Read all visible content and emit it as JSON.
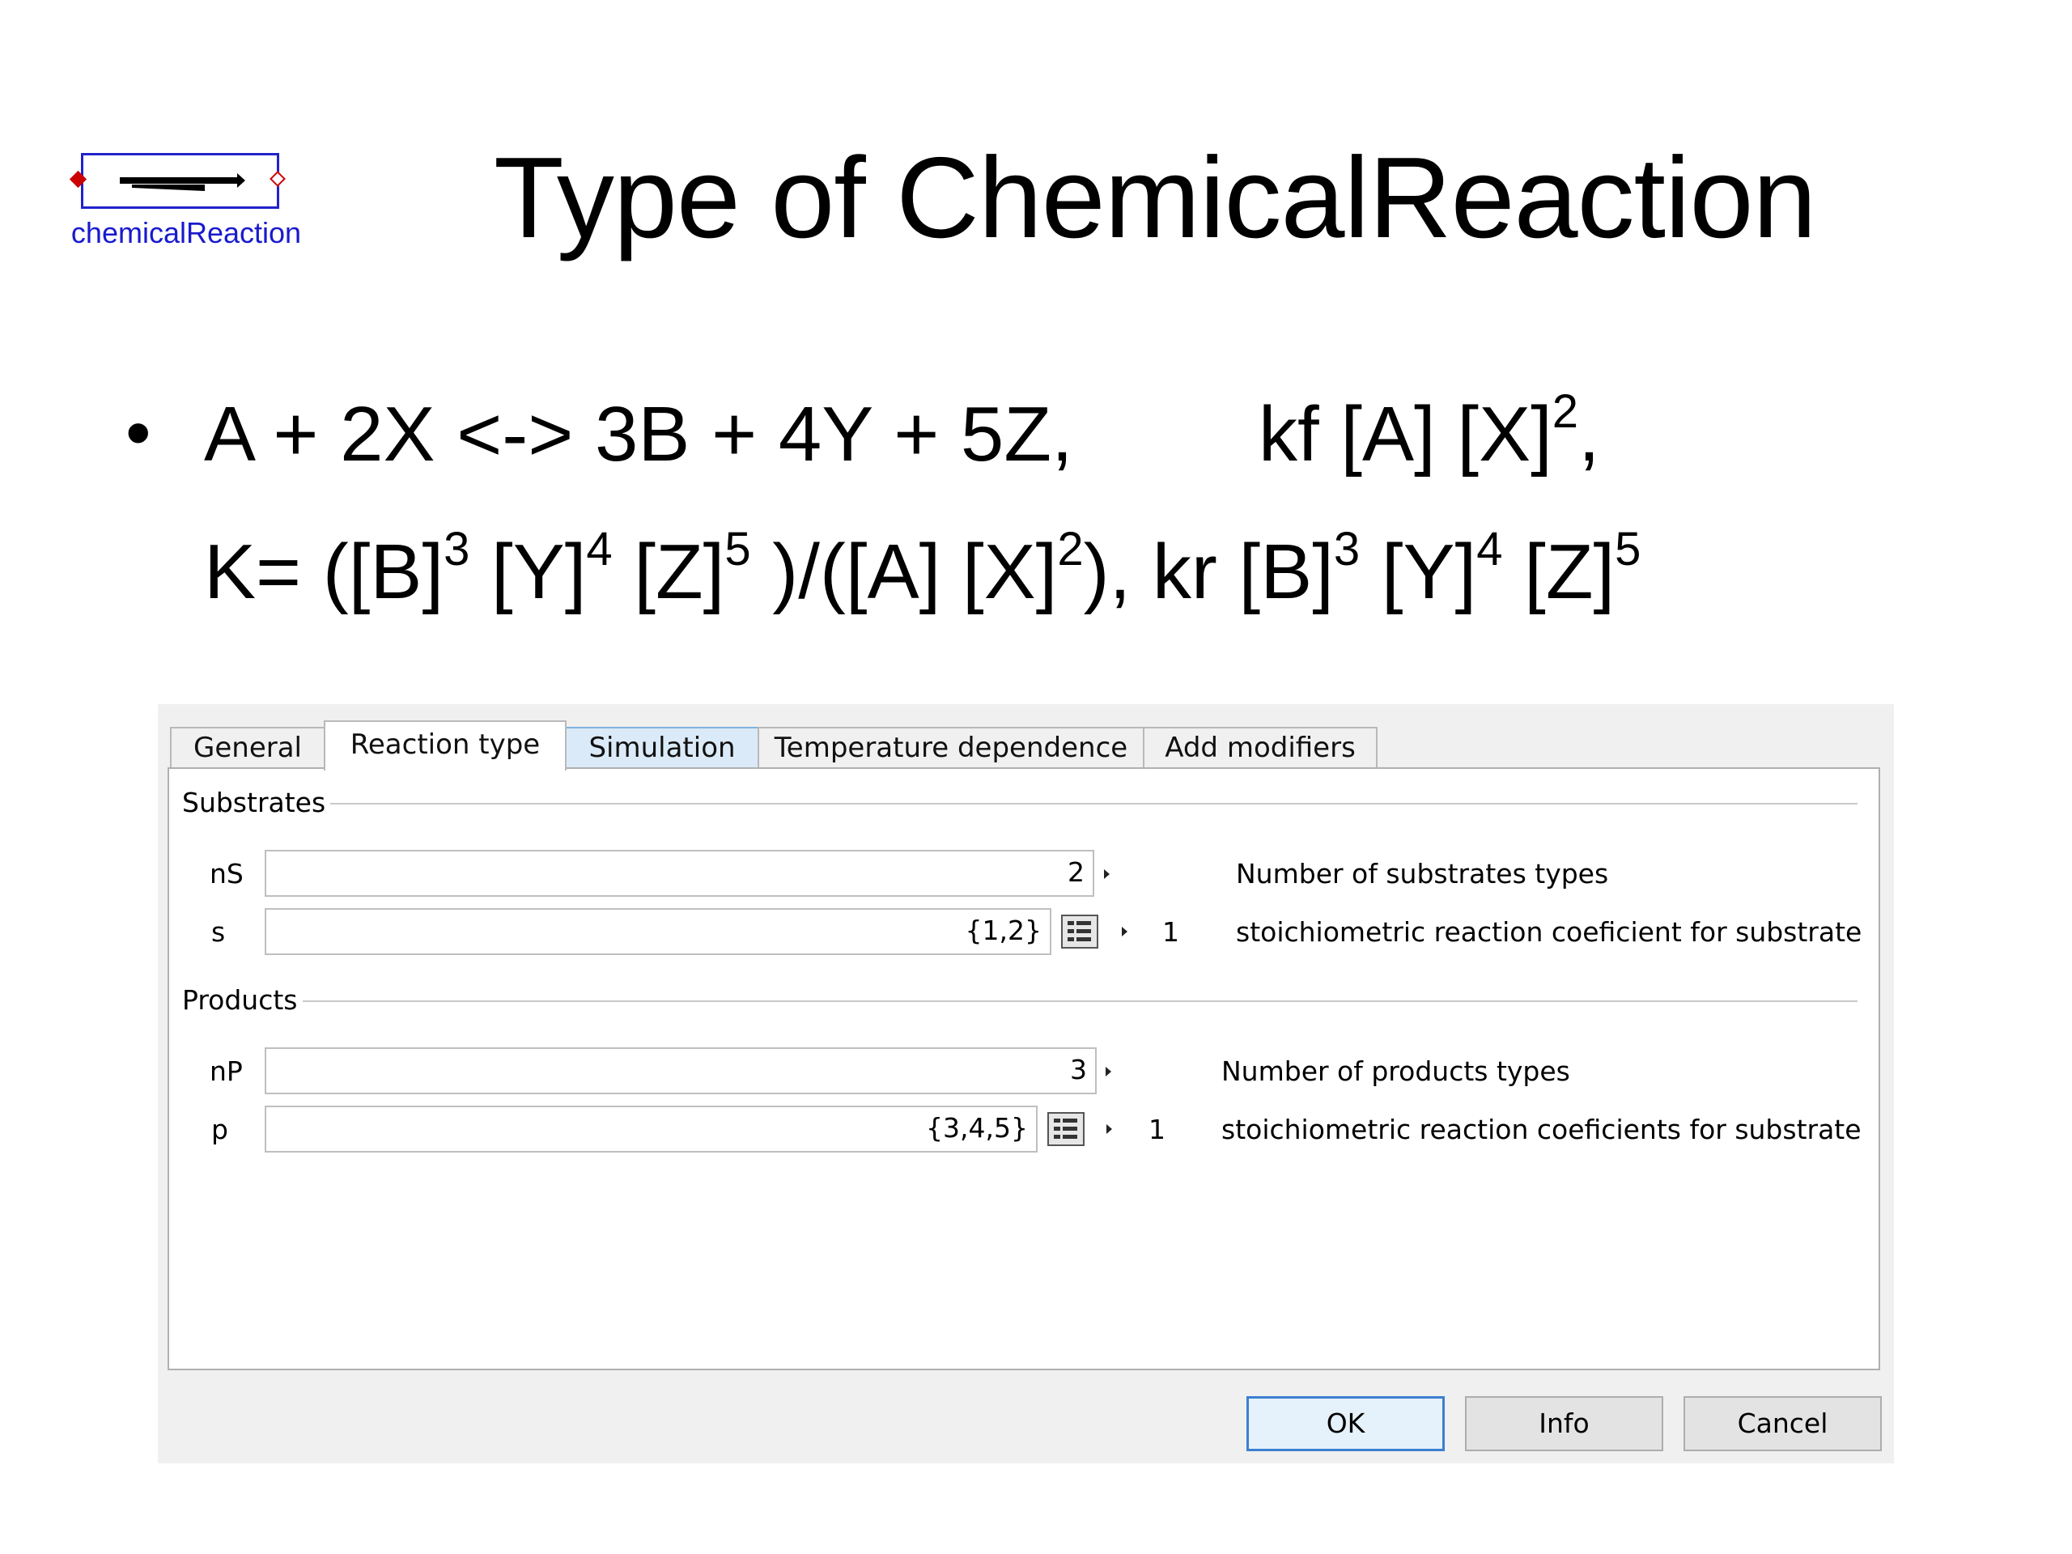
{
  "component": {
    "label": "chemicalReaction"
  },
  "slide": {
    "title": "Type of ChemicalReaction",
    "bullet": "•",
    "eq1_left": "A + 2X <-> 3B + 4Y + 5Z,",
    "eq1_right_a": "kf [A] [X]",
    "eq1_right_sup": "2",
    "eq1_right_b": ",",
    "eq2": {
      "t1": "K= ([B]",
      "s1": "3",
      "t2": " [Y]",
      "s2": "4",
      "t3": " [Z]",
      "s3": "5",
      "t4": " )/([A] [X]",
      "s4": "2",
      "t5": "),  kr [B]",
      "s5": "3",
      "t6": " [Y]",
      "s6": "4",
      "t7": " [Z]",
      "s7": "5"
    }
  },
  "dialog": {
    "tabs": [
      "General",
      "Reaction type",
      "Simulation",
      "Temperature dependence",
      "Add modifiers"
    ],
    "active_tab": "Reaction type",
    "substrates": {
      "title": "Substrates",
      "nS": {
        "name": "nS",
        "value": "2",
        "description": "Number of substrates types"
      },
      "s": {
        "name": "s",
        "value": "{1,2}",
        "unit": "1",
        "description": "stoichiometric reaction coeficient for substrate"
      }
    },
    "products": {
      "title": "Products",
      "nP": {
        "name": "nP",
        "value": "3",
        "description": "Number of products types"
      },
      "p": {
        "name": "p",
        "value": "{3,4,5}",
        "unit": "1",
        "description": "stoichiometric reaction coeficients for substrate"
      }
    },
    "buttons": {
      "ok": "OK",
      "info": "Info",
      "cancel": "Cancel"
    }
  },
  "colors": {
    "icon_border": "#2222cc",
    "port": "#cc0000",
    "default_button": "#3c7fd1",
    "tab_hover": "#dbeaf8"
  }
}
